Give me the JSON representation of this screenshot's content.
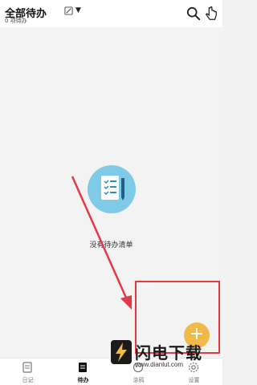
{
  "header": {
    "title": "全部待办",
    "subtitle": "0 项待办",
    "icons": [
      "edit-icon",
      "caret-down-icon",
      "search-icon",
      "touch-icon"
    ]
  },
  "empty_state": {
    "message": "没有待办清单"
  },
  "fab": {
    "symbol": "+",
    "color": "#f1b84a"
  },
  "tabs": [
    {
      "label": "日记",
      "icon": "diary-icon",
      "active": false
    },
    {
      "label": "待办",
      "icon": "todo-icon",
      "active": true
    },
    {
      "label": "涂鸦",
      "icon": "doodle-icon",
      "active": false
    },
    {
      "label": "设置",
      "icon": "settings-icon",
      "active": false
    }
  ],
  "watermark": {
    "brand": "闪电下载",
    "url": "www.dianlut.com"
  },
  "colors": {
    "accent": "#f1b84a",
    "highlight": "#e23a46",
    "illustration": "#7fcbe7"
  }
}
